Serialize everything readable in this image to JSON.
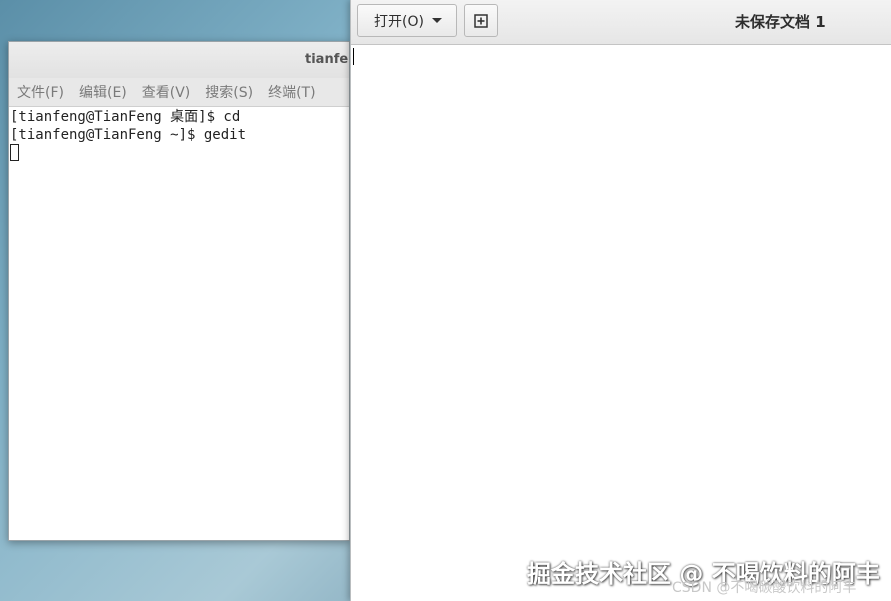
{
  "terminal": {
    "title": "tianfen",
    "menu": [
      "文件(F)",
      "编辑(E)",
      "查看(V)",
      "搜索(S)",
      "终端(T)"
    ],
    "lines": [
      "[tianfeng@TianFeng 桌面]$ cd",
      "[tianfeng@TianFeng ~]$ gedit"
    ]
  },
  "gedit": {
    "open_label": "打开(O)",
    "new_icon": "new-document-icon",
    "title": "未保存文档 1"
  },
  "watermark": {
    "main": "掘金技术社区 @ 不喝饮料的阿丰",
    "sub": "CSDN @不喝碳酸饮料的阿丰"
  }
}
